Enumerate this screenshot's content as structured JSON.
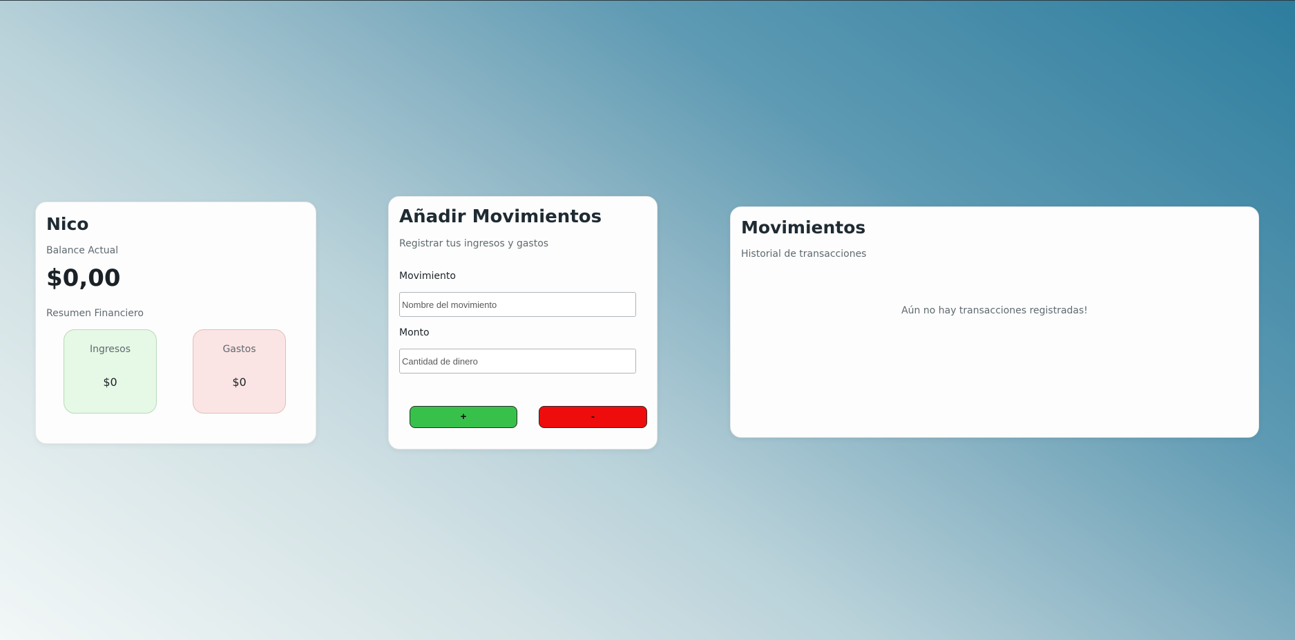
{
  "balance_card": {
    "user_name": "Nico",
    "balance_label": "Balance Actual",
    "balance_amount": "$0,00",
    "summary_label": "Resumen Financiero",
    "income": {
      "label": "Ingresos",
      "value": "$0",
      "color": "#e6f8e6"
    },
    "expenses": {
      "label": "Gastos",
      "value": "$0",
      "color": "#fbe4e4"
    }
  },
  "add_card": {
    "title": "Añadir Movimientos",
    "subtitle": "Registrar tus ingresos y gastos",
    "movement_label": "Movimiento",
    "movement_placeholder": "Nombre del movimiento",
    "amount_label": "Monto",
    "amount_placeholder": "Cantidad de dinero",
    "add_button": {
      "label": "+",
      "color": "#38c14a"
    },
    "subtract_button": {
      "label": "-",
      "color": "#ee0c0c"
    }
  },
  "history_card": {
    "title": "Movimientos",
    "subtitle": "Historial de transacciones",
    "empty_message": "Aún no hay transacciones registradas!"
  }
}
